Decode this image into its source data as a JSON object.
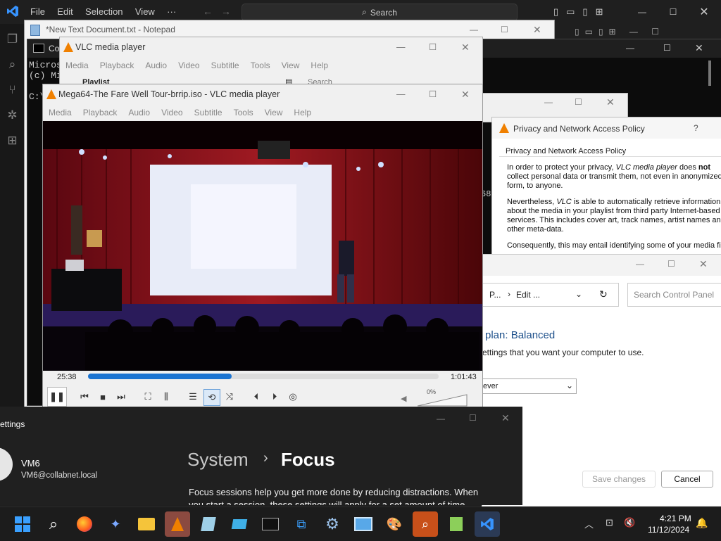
{
  "vscode": {
    "menu": [
      "File",
      "Edit",
      "Selection",
      "View",
      "···"
    ],
    "search_label": "Search",
    "accent": "#3794ff"
  },
  "notepad": {
    "title": "*New Text Document.txt - Notepad"
  },
  "cmd": {
    "title": "Co",
    "lines": [
      "Micros",
      "(c) Mi",
      "",
      "C:\\"
    ],
    "side_number": "68"
  },
  "vlc_back": {
    "title": "VLC media player",
    "menu": [
      "Media",
      "Playback",
      "Audio",
      "Video",
      "Subtitle",
      "Tools",
      "View",
      "Help"
    ],
    "playlist_label": "Playlist",
    "search_placeholder": "Search"
  },
  "vlc_main": {
    "title": "Mega64-The Fare Well Tour-brrip.iso - VLC media player",
    "menu": [
      "Media",
      "Playback",
      "Audio",
      "Video",
      "Subtitle",
      "Tools",
      "View",
      "Help"
    ],
    "time_elapsed": "25:38",
    "time_total": "1:01:43",
    "progress_fraction": 0.41,
    "volume_label": "0%",
    "volume_fraction": 0.0,
    "brand_color": "#f08000",
    "progress_color": "#1b74d2"
  },
  "privacy": {
    "title": "Privacy and Network Access Policy",
    "help": "?",
    "group_label": "Privacy and Network Access Policy",
    "para1_a": "In order to protect your privacy, ",
    "para1_em": "VLC media player",
    "para1_b": " does ",
    "para1_strong": "not",
    "para1_c": " collect personal data or transmit them, not even in anonymized form, to anyone.",
    "para2_a": "Nevertheless, ",
    "para2_em": "VLC",
    "para2_b": " is able to automatically retrieve information about the media in your playlist from third party Internet-based services. This includes cover art, track names, artist names and other meta-data.",
    "para3": "Consequently, this may entail identifying some of your media fil"
  },
  "control_panel": {
    "breadcrumb_1": "P...",
    "breadcrumb_2": "Edit ...",
    "search_placeholder": "Search Control Panel",
    "heading": "plan: Balanced",
    "subtext": "ettings that you want your computer to use.",
    "select_value": "ever",
    "save_label": "Save changes",
    "cancel_label": "Cancel",
    "heading_color": "#1c4f8a"
  },
  "settings": {
    "title": "ettings",
    "user_name": "VM6",
    "user_email": "VM6@collabnet.local",
    "crumb_parent": "System",
    "crumb_sep": "›",
    "crumb_current": "Focus",
    "desc_1": "Focus sessions help you get more done by reducing distractions. When",
    "desc_2": "you start a session, these settings will apply for a set amount of time."
  },
  "taskbar": {
    "time": "4:21 PM",
    "date": "11/12/2024",
    "icons": [
      "windows-start",
      "search",
      "firefox",
      "bird-app",
      "file-explorer",
      "vlc",
      "notepad-app",
      "generic-app",
      "terminal",
      "network-app",
      "settings-gear",
      "remote-desktop",
      "paint-app",
      "magnifier",
      "notepad-plus",
      "vscode"
    ]
  }
}
